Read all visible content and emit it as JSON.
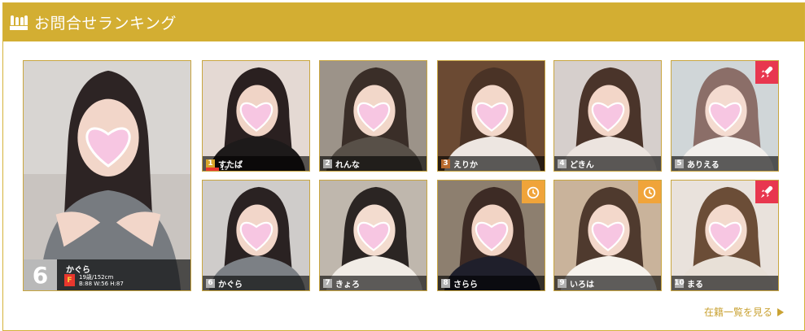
{
  "header": {
    "title": "お問合せランキング"
  },
  "featured": {
    "rank": "6",
    "name": "かぐら",
    "cup": "F",
    "profile_line1": "19歳/152cm",
    "profile_line2": "B:88 W:56 H:87"
  },
  "cards": [
    {
      "rank": "1",
      "name": "すたば",
      "rank_color": "#d8a52a",
      "badge": "none",
      "sub_text": "19歳/150cm"
    },
    {
      "rank": "2",
      "name": "れんな",
      "rank_color": "#a8a8a8",
      "badge": "none"
    },
    {
      "rank": "3",
      "name": "えりか",
      "rank_color": "#b8692d",
      "badge": "none"
    },
    {
      "rank": "4",
      "name": "どきん",
      "rank_color": "#b0b0b0",
      "badge": "none"
    },
    {
      "rank": "5",
      "name": "ありえる",
      "rank_color": "#b0b0b0",
      "badge": "rocket-icon"
    },
    {
      "rank": "6",
      "name": "かぐら",
      "rank_color": "#b0b0b0",
      "badge": "none"
    },
    {
      "rank": "7",
      "name": "きょろ",
      "rank_color": "#b0b0b0",
      "badge": "none"
    },
    {
      "rank": "8",
      "name": "さらら",
      "rank_color": "#b0b0b0",
      "badge": "clock-icon"
    },
    {
      "rank": "9",
      "name": "いろは",
      "rank_color": "#b0b0b0",
      "badge": "clock-icon"
    },
    {
      "rank": "10",
      "name": "まる",
      "rank_color": "#b0b0b0",
      "badge": "rocket-icon"
    }
  ],
  "more_link": {
    "label": "在籍一覧を見る"
  },
  "colors": {
    "accent": "#d3ae32",
    "heart": "#f7c6e2",
    "badge_red": "#e8374f",
    "badge_orange": "#f0a43a"
  }
}
